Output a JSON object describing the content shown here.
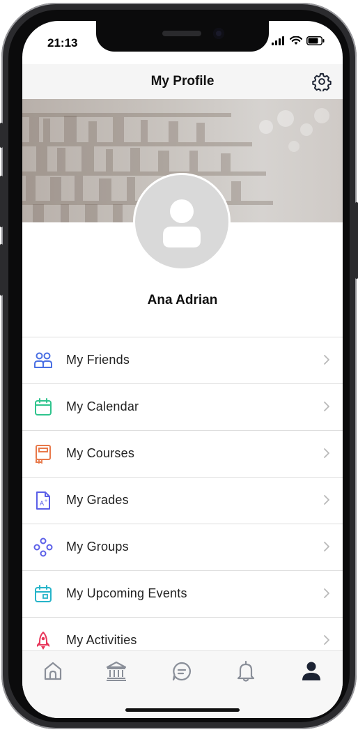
{
  "status_bar": {
    "time": "21:13"
  },
  "header": {
    "title": "My Profile",
    "settings_icon": "gear-icon"
  },
  "profile": {
    "name": "Ana Adrian",
    "avatar_icon": "user-silhouette-icon"
  },
  "menu": {
    "items": [
      {
        "label": "My Friends",
        "icon": "friends-icon",
        "color": "#4a6fe3"
      },
      {
        "label": "My Calendar",
        "icon": "calendar-icon",
        "color": "#2fc48d"
      },
      {
        "label": "My Courses",
        "icon": "book-icon",
        "color": "#e8794a"
      },
      {
        "label": "My Grades",
        "icon": "grade-document-icon",
        "color": "#5b5fe8"
      },
      {
        "label": "My Groups",
        "icon": "groups-icon",
        "color": "#5b5fe8"
      },
      {
        "label": "My Upcoming Events",
        "icon": "calendar-event-icon",
        "color": "#26b4c9"
      },
      {
        "label": "My Activities",
        "icon": "rocket-icon",
        "color": "#e8365a"
      }
    ]
  },
  "tabbar": {
    "tabs": [
      {
        "icon": "home-icon",
        "active": false
      },
      {
        "icon": "institution-icon",
        "active": false
      },
      {
        "icon": "chat-icon",
        "active": false
      },
      {
        "icon": "bell-icon",
        "active": false
      },
      {
        "icon": "profile-icon",
        "active": true
      }
    ]
  }
}
